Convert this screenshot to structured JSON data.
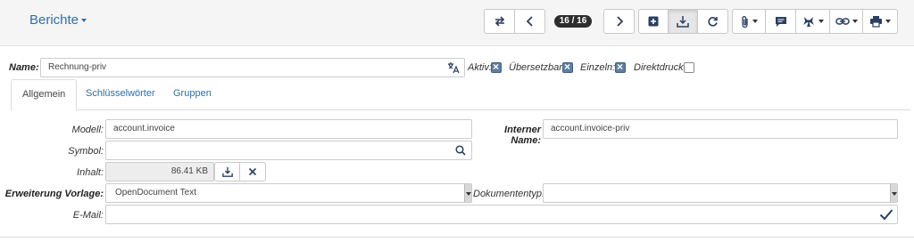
{
  "header": {
    "title": "Berichte",
    "record_counter": "16 / 16"
  },
  "toolbar": {
    "icons": [
      "switch-view-icon",
      "previous-icon",
      "next-icon",
      "new-record-icon",
      "save-icon",
      "reload-icon",
      "attachment-icon",
      "note-icon",
      "action-icon",
      "relate-icon",
      "print-icon"
    ]
  },
  "form": {
    "name_label": "Name:",
    "name_value": "Rechnung-priv",
    "aktiv_label": "Aktiv:",
    "aktiv_checked": true,
    "uebersetzbar_label": "Übersetzbar:",
    "uebersetzbar_checked": true,
    "einzeln_label": "Einzeln:",
    "einzeln_checked": true,
    "direktdruck_label": "Direktdruck:",
    "direktdruck_checked": false
  },
  "tabs": [
    {
      "label": "Allgemein",
      "active": true
    },
    {
      "label": "Schlüsselwörter",
      "active": false
    },
    {
      "label": "Gruppen",
      "active": false
    }
  ],
  "general": {
    "modell_label": "Modell:",
    "modell_value": "account.invoice",
    "interner_name_label": "Interner Name:",
    "interner_name_value": "account.invoice-priv",
    "symbol_label": "Symbol:",
    "symbol_value": "",
    "inhalt_label": "Inhalt:",
    "inhalt_value": "86.41 KB",
    "erweiterung_label": "Erweiterung Vorlage:",
    "erweiterung_value": "OpenDocument Text",
    "dokumententyp_label": "Dokumententyp:",
    "dokumententyp_value": "",
    "email_label": "E-Mail:",
    "email_value": ""
  },
  "colors": {
    "accent": "#2f6fa8",
    "checkbox_checked": "#5e7fa3",
    "badge": "#2d2d2d"
  }
}
